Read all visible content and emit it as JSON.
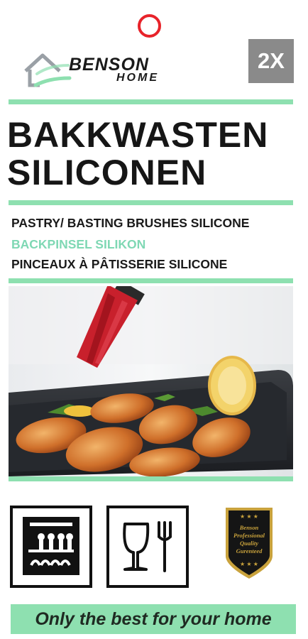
{
  "brand": {
    "name_top": "BENSON",
    "name_bottom": "HOME"
  },
  "badge": {
    "quantity": "2X"
  },
  "title": {
    "line1": "BAKKWASTEN",
    "line2": "SILICONEN"
  },
  "subtitles": {
    "english": "PASTRY/ BASTING BRUSHES SILICONE",
    "german": "BACKPINSEL SILIKON",
    "french": "PINCEAUX À PÂTISSERIE SILICONE"
  },
  "quality_badge": {
    "l1": "Benson",
    "l2": "Professional",
    "l3": "Quality",
    "l4": "Gurenteed"
  },
  "tagline": "Only the best for your home",
  "colors": {
    "accent_green": "#8ee0b0",
    "subtitle_green": "#7fd8b4",
    "hang_ring_red": "#e8232a",
    "brush_red": "#c8202c",
    "badge_gold": "#c9a23c"
  },
  "icons": [
    "house-logo-icon",
    "dishwasher-safe-icon",
    "food-safe-icon",
    "quality-shield-icon"
  ]
}
